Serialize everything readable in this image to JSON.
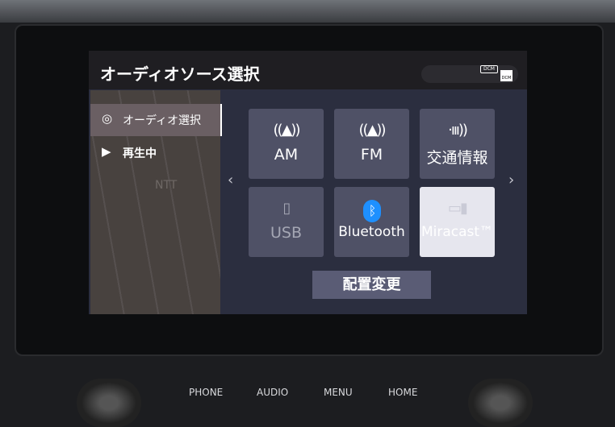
{
  "title": "オーディオソース選択",
  "status": {
    "dcm1": "DCM",
    "dcm2": "DCM"
  },
  "sidebar": {
    "items": [
      {
        "label": "オーディオ選択",
        "icon": "disc-phone-icon",
        "selected": true
      },
      {
        "label": "再生中",
        "icon": "play-circle-icon"
      }
    ]
  },
  "map": {
    "label": "NTT"
  },
  "sources": [
    {
      "label": "AM",
      "icon": "antenna-icon"
    },
    {
      "label": "FM",
      "icon": "antenna-icon"
    },
    {
      "label": "交通情報",
      "icon": "signal-icon"
    },
    {
      "label": "USB",
      "icon": "usb-icon",
      "disabled": true
    },
    {
      "label": "Bluetooth",
      "icon": "bluetooth-icon"
    },
    {
      "label": "Miracast™",
      "icon": "screen-mirror-icon",
      "highlighted": true
    }
  ],
  "rearrange_label": "配置変更",
  "hardware": [
    "PHONE",
    "AUDIO",
    "MENU",
    "HOME"
  ],
  "colors": {
    "tile": "#4f5166",
    "bluetooth": "#1e90ff"
  }
}
